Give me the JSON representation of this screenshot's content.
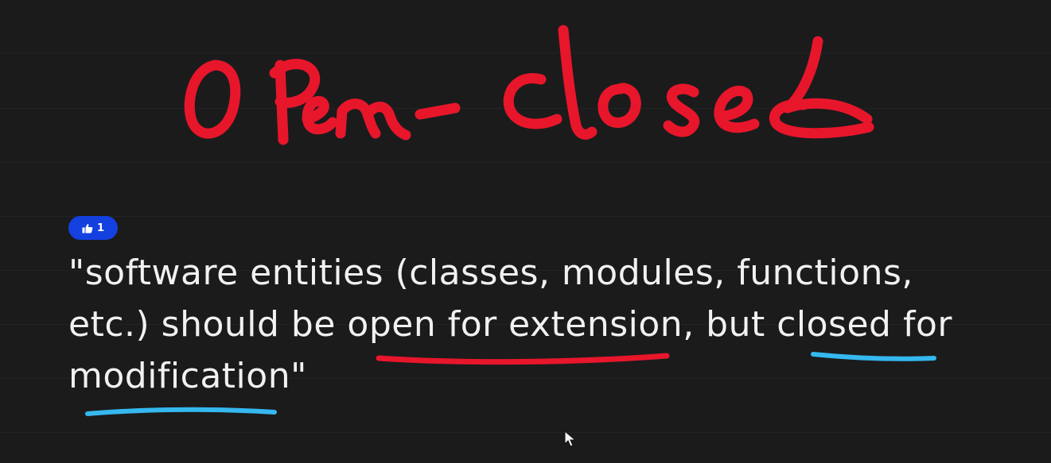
{
  "title_ink": {
    "text": "Open- closed",
    "color": "#e8162b"
  },
  "reaction": {
    "icon": "thumbs-up-icon",
    "count": "1",
    "color": "#1440e0"
  },
  "quote": {
    "line1": "\"software entities (classes, modules, functions,",
    "line2_a": "etc.) should be ",
    "line2_b": "open for extension",
    "line2_c": ", but ",
    "line2_d": "closed",
    "line2_e": " for",
    "line3_a": "modification",
    "line3_b": "\""
  },
  "underline_colors": {
    "red": "#e8162b",
    "blue": "#35b8ee"
  },
  "cursor": {
    "icon": "mouse-pointer-icon"
  }
}
